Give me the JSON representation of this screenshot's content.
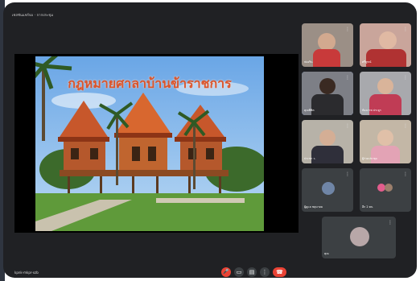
{
  "window": {
    "title": "เซสชันแชร์จอ · การประชุม"
  },
  "presentation": {
    "slide_title": "กฎหมายศาลาบ้านข้าราชการ"
  },
  "participants": [
    {
      "name": "ฟองริน",
      "mic": "⋮"
    },
    {
      "name": "ศรีพูรณ์",
      "mic": "⋮"
    },
    {
      "name": "คุณพิชิต",
      "mic": "⋮"
    },
    {
      "name": "ห้องภาพ ประยูร",
      "mic": "⋮"
    },
    {
      "name": "ประชา ว.",
      "mic": "⋮"
    },
    {
      "name": "ผู้ร่วมประชุม",
      "mic": "⋮"
    },
    {
      "name": "ผู้ดูแล ขยุนายม",
      "mic": "⋮"
    },
    {
      "name": "อีก 2 คน",
      "mic": "⋮"
    },
    {
      "name": "คุณ",
      "mic": "⋮"
    }
  ],
  "footer": {
    "meeting_code": "kpnk-mkpr-xzb"
  },
  "controls": {
    "mic_icon": "🎤",
    "cam_icon": "▭",
    "cc_icon": "▤",
    "more_icon": "⋮",
    "hang_icon": "☎"
  },
  "colors": {
    "accent": "#8ab4f8",
    "danger": "#ea4335",
    "bg": "#202124"
  }
}
